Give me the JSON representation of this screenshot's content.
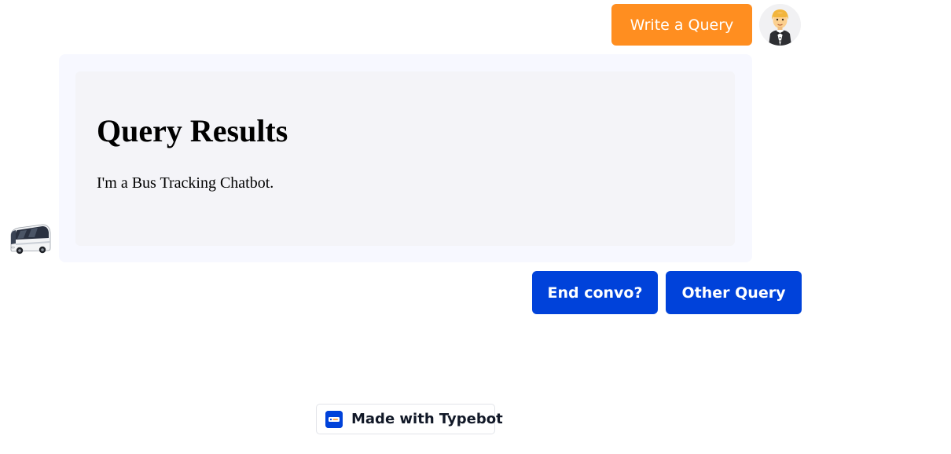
{
  "chat": {
    "user_message": "Write a Query",
    "bot_message": {
      "heading": "Query Results",
      "body": "I'm a Bus Tracking Chatbot."
    },
    "choices": [
      "End convo?",
      "Other Query"
    ]
  },
  "avatars": {
    "user": "man-in-tuxedo-icon",
    "bot": "bus-icon"
  },
  "branding": {
    "label": "Made with Typebot",
    "icon": "typebot-logo-icon"
  },
  "colors": {
    "user_bubble": "#ff8e20",
    "button": "#0042da",
    "bot_bubble": "#f7f8ff"
  }
}
